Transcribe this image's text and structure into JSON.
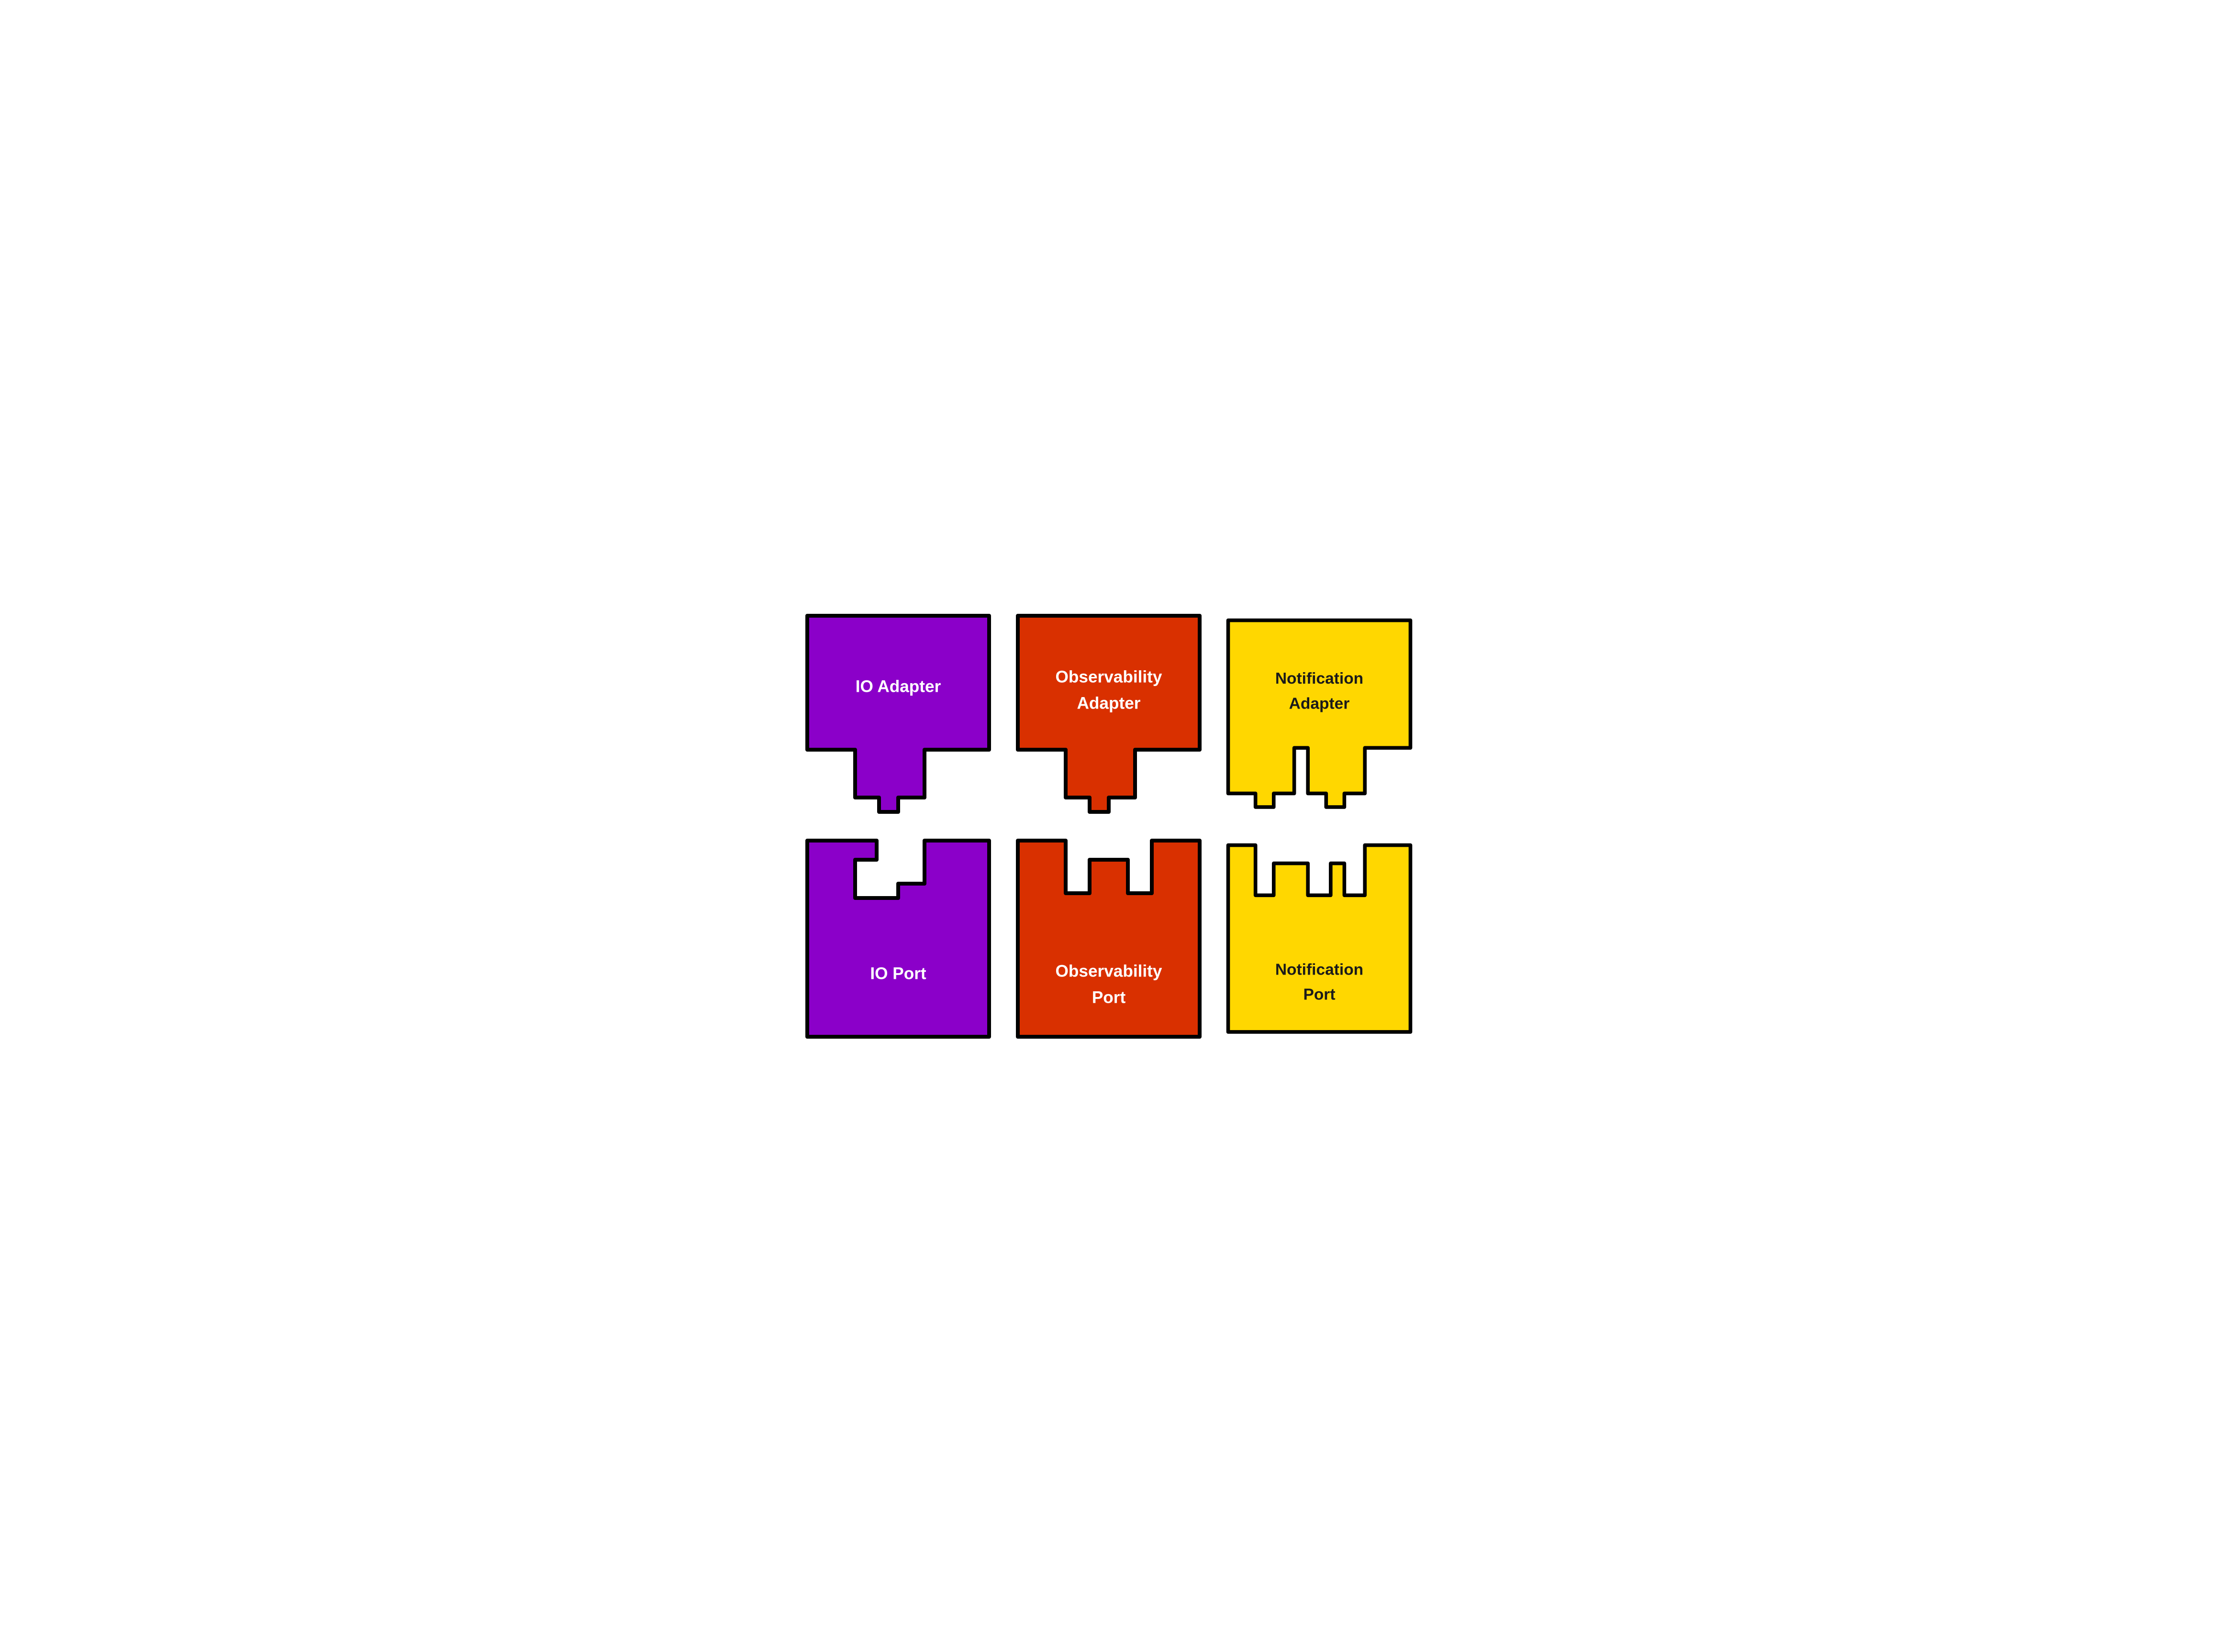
{
  "pieces": [
    {
      "id": "io-adapter",
      "label": "IO Adapter",
      "color": "#8B00C9",
      "stroke": "#000000",
      "textColor": "white",
      "type": "adapter-single",
      "row": 1,
      "col": 1
    },
    {
      "id": "observability-adapter",
      "label": "Observability\nAdapter",
      "color": "#D93000",
      "stroke": "#000000",
      "textColor": "white",
      "type": "adapter-single",
      "row": 1,
      "col": 2
    },
    {
      "id": "notification-adapter",
      "label": "Notification Adapter",
      "color": "#FFD700",
      "stroke": "#000000",
      "textColor": "#1a1a1a",
      "type": "adapter-double",
      "row": 1,
      "col": 3
    },
    {
      "id": "io-port",
      "label": "IO Port",
      "color": "#8B00C9",
      "stroke": "#000000",
      "textColor": "white",
      "type": "port-single",
      "row": 2,
      "col": 1
    },
    {
      "id": "observability-port",
      "label": "Observability\nPort",
      "color": "#D93000",
      "stroke": "#000000",
      "textColor": "white",
      "type": "port-single",
      "row": 2,
      "col": 2
    },
    {
      "id": "notification-port",
      "label": "Notification Port",
      "color": "#FFD700",
      "stroke": "#000000",
      "textColor": "#1a1a1a",
      "type": "port-double",
      "row": 2,
      "col": 3
    }
  ]
}
